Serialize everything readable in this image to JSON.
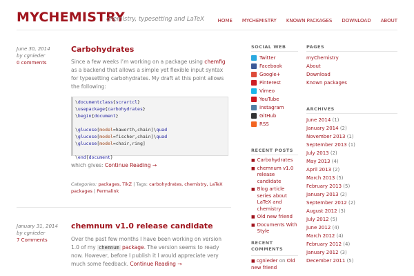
{
  "header": {
    "title": "MYCHEMISTRY",
    "tagline": "chemistry, typesetting and LaTeX",
    "nav": [
      "HOME",
      "MYCHEMISTRY",
      "KNOWN PACKAGES",
      "DOWNLOAD",
      "ABOUT"
    ]
  },
  "posts": [
    {
      "date": "June 30, 2014",
      "by": "by cgnieder",
      "comments": "0 comments",
      "title": "Carbohydrates",
      "intro_a": "Since a few weeks I’m working on a package using",
      "intro_link": "chemfig",
      "intro_b": "as a backend that allows a simple yet flexible input syntax for typesetting carbohydrates. My draft at this point allows the following:",
      "code": [
        "\\documentclass{scrartcl}",
        "\\usepackage{carbohydrates}",
        "\\begin{document}",
        "",
        "\\glucose[model=haworth,chain]\\quad",
        "\\glucose[model=fischer,chain]\\quad",
        "\\glucose[model=chair,ring]",
        "",
        "\\end{document}"
      ],
      "after_code": "which gives:",
      "continue": "Continue Reading →",
      "categories_label": "Categories:",
      "categories": "packages, TikZ",
      "tags_label": "| Tags:",
      "tags": "carbohydrates, chemistry, LaTeX packages",
      "permalink": "Permalink"
    },
    {
      "date": "January 31, 2014",
      "by": "by cgnieder",
      "comments": "7 Comments",
      "title": "chemnum v1.0 release candidate",
      "text_a": "Over the past few months I have been working on version 1.0 of my",
      "text_code": "chemnum",
      "text_link": "package",
      "text_b": ". The version seems to ready now. However, before I publish it I would appreciate very much some feedback.",
      "continue": "Continue Reading →"
    }
  ],
  "sidebar": {
    "social_title": "SOCIAL WEB",
    "social": [
      {
        "label": "Twitter",
        "color": "#2aa9e0",
        "icon": "twitter-icon"
      },
      {
        "label": "Facebook",
        "color": "#3b5998",
        "icon": "facebook-icon"
      },
      {
        "label": "Google+",
        "color": "#dd4b39",
        "icon": "googleplus-icon"
      },
      {
        "label": "Pinterest",
        "color": "#cb2027",
        "icon": "pinterest-icon"
      },
      {
        "label": "Vimeo",
        "color": "#1ab7ea",
        "icon": "vimeo-icon"
      },
      {
        "label": "YouTube",
        "color": "#cc181e",
        "icon": "youtube-icon"
      },
      {
        "label": "Instagram",
        "color": "#517fa4",
        "icon": "instagram-icon"
      },
      {
        "label": "GitHub",
        "color": "#333333",
        "icon": "github-icon"
      },
      {
        "label": "RSS",
        "color": "#f26522",
        "icon": "rss-icon"
      }
    ],
    "recent_posts_title": "RECENT POSTS",
    "recent_posts": [
      "Carbohydrates",
      "chemnum v1.0 release candidate",
      "Blog article series about LaTeX and chemistry",
      "Old new friend",
      "Documents With Style"
    ],
    "recent_comments_title": "RECENT COMMENTS",
    "recent_comment": {
      "author": "cgnieder",
      "on": "on",
      "post": "Old new friend"
    },
    "pages_title": "PAGES",
    "pages": [
      "myChemistry",
      "About",
      "Download",
      "Known packages"
    ],
    "archives_title": "ARCHIVES",
    "archives": [
      {
        "month": "June 2014",
        "count": "(1)"
      },
      {
        "month": "January 2014",
        "count": "(2)"
      },
      {
        "month": "November 2013",
        "count": "(1)"
      },
      {
        "month": "September 2013",
        "count": "(1)"
      },
      {
        "month": "July 2013",
        "count": "(2)"
      },
      {
        "month": "May 2013",
        "count": "(4)"
      },
      {
        "month": "April 2013",
        "count": "(2)"
      },
      {
        "month": "March 2013",
        "count": "(5)"
      },
      {
        "month": "February 2013",
        "count": "(5)"
      },
      {
        "month": "January 2013",
        "count": "(2)"
      },
      {
        "month": "September 2012",
        "count": "(2)"
      },
      {
        "month": "August 2012",
        "count": "(3)"
      },
      {
        "month": "July 2012",
        "count": "(5)"
      },
      {
        "month": "June 2012",
        "count": "(4)"
      },
      {
        "month": "March 2012",
        "count": "(4)"
      },
      {
        "month": "February 2012",
        "count": "(4)"
      },
      {
        "month": "January 2012",
        "count": "(3)"
      },
      {
        "month": "December 2011",
        "count": "(5)"
      }
    ]
  }
}
